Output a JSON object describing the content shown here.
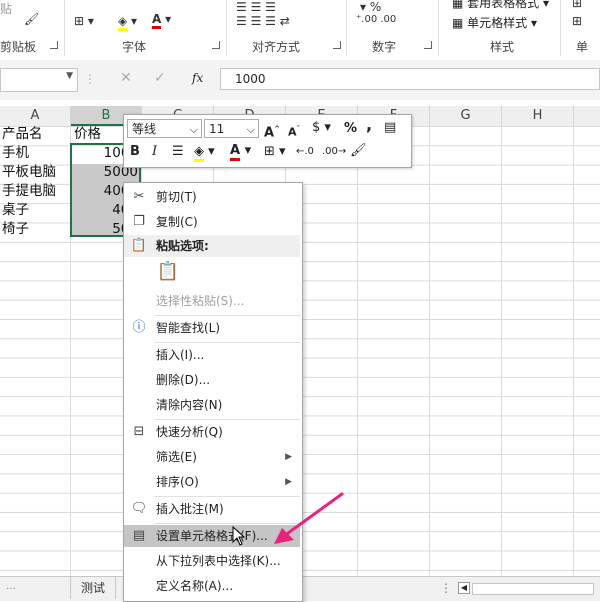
{
  "ribbon": {
    "clipboard_label": "剪贴板",
    "paste_fragment": "贴",
    "font_label": "字体",
    "align_label": "对齐方式",
    "number_label": "数字",
    "styles_label": "样式",
    "cells_label": "单",
    "table_format_label": "套用表格格式",
    "cell_styles_label": "单元格样式",
    "percent_symbol": "%",
    "font_color_letter": "A"
  },
  "formula_bar": {
    "name_box": "",
    "fx_label": "fx",
    "value": "1000"
  },
  "columns": [
    "A",
    "B",
    "C",
    "D",
    "E",
    "F",
    "G",
    "H"
  ],
  "cells": {
    "header_a": "产品名",
    "header_b": "价格",
    "rows": [
      {
        "name": "手机",
        "price": "1000"
      },
      {
        "name": "平板电脑",
        "price": "5000"
      },
      {
        "name": "手提电脑",
        "price": "4000"
      },
      {
        "name": "桌子",
        "price": "400"
      },
      {
        "name": "椅子",
        "price": "500"
      }
    ]
  },
  "mini_toolbar": {
    "font_name": "等线",
    "font_size": "11",
    "bold": "B",
    "italic": "I",
    "currency": "$",
    "percent": "%",
    "comma": ","
  },
  "context_menu": {
    "items": [
      {
        "label": "剪切(T)",
        "icon": "scissors-icon"
      },
      {
        "label": "复制(C)",
        "icon": "copy-icon"
      },
      {
        "label": "粘贴选项:",
        "icon": "paste-icon"
      },
      {
        "label": "选择性粘贴(S)...",
        "disabled": true
      },
      {
        "label": "智能查找(L)",
        "icon": "smart-lookup-icon"
      },
      {
        "label": "插入(I)..."
      },
      {
        "label": "删除(D)..."
      },
      {
        "label": "清除内容(N)"
      },
      {
        "label": "快速分析(Q)",
        "icon": "quick-analysis-icon"
      },
      {
        "label": "筛选(E)",
        "submenu": true
      },
      {
        "label": "排序(O)",
        "submenu": true
      },
      {
        "label": "插入批注(M)",
        "icon": "comment-icon"
      },
      {
        "label": "设置单元格格式(F)...",
        "icon": "format-cells-icon",
        "highlighted": true
      },
      {
        "label": "从下拉列表中选择(K)..."
      },
      {
        "label": "定义名称(A)..."
      }
    ]
  },
  "sheet_tabs": [
    "测试"
  ],
  "colors": {
    "selection_border": "#217346",
    "annotation_arrow": "#e8237f",
    "highlight_bg": "#c5c5c5"
  }
}
